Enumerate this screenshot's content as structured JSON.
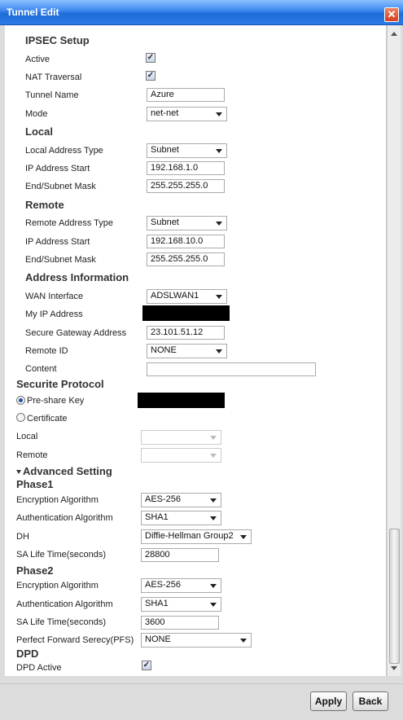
{
  "window": {
    "title": "Tunnel Edit",
    "close": "✕"
  },
  "ipsec": {
    "heading": "IPSEC Setup",
    "active_label": "Active",
    "nat_label": "NAT Traversal",
    "tunnel_name_label": "Tunnel Name",
    "tunnel_name_value": "Azure",
    "mode_label": "Mode",
    "mode_value": "net-net"
  },
  "local": {
    "heading": "Local",
    "address_type_label": "Local Address Type",
    "address_type_value": "Subnet",
    "ip_start_label": "IP Address Start",
    "ip_start_value": "192.168.1.0",
    "mask_label": "End/Subnet Mask",
    "mask_value": "255.255.255.0"
  },
  "remote": {
    "heading": "Remote",
    "address_type_label": "Remote Address Type",
    "address_type_value": "Subnet",
    "ip_start_label": "IP Address Start",
    "ip_start_value": "192.168.10.0",
    "mask_label": "End/Subnet Mask",
    "mask_value": "255.255.255.0"
  },
  "address_info": {
    "heading": "Address Information",
    "wan_label": "WAN Interface",
    "wan_value": "ADSLWAN1",
    "my_ip_label": "My IP Address",
    "gateway_label": "Secure Gateway Address",
    "gateway_value": "23.101.51.12",
    "remote_id_label": "Remote ID",
    "remote_id_value": "NONE",
    "content_label": "Content",
    "content_value": ""
  },
  "protocol": {
    "heading": "Securite Protocol",
    "preshare_label": "Pre-share Key",
    "certificate_label": "Certificate",
    "local_label": "Local",
    "remote_label": "Remote"
  },
  "advanced": {
    "heading": "Advanced Setting"
  },
  "phase1": {
    "heading": "Phase1",
    "enc_label": "Encryption Algorithm",
    "enc_value": "AES-256",
    "auth_label": "Authentication Algorithm",
    "auth_value": "SHA1",
    "dh_label": "DH",
    "dh_value": "Diffie-Hellman Group2",
    "life_label": "SA Life Time(seconds)",
    "life_value": "28800"
  },
  "phase2": {
    "heading": "Phase2",
    "enc_label": "Encryption Algorithm",
    "enc_value": "AES-256",
    "auth_label": "Authentication Algorithm",
    "auth_value": "SHA1",
    "life_label": "SA Life Time(seconds)",
    "life_value": "3600",
    "pfs_label": "Perfect Forward Serecy(PFS)",
    "pfs_value": "NONE"
  },
  "dpd": {
    "heading": "DPD",
    "active_label": "DPD Active"
  },
  "footer": {
    "apply": "Apply",
    "back": "Back"
  },
  "checks": {
    "mark": "✓"
  },
  "colors": {
    "titlebar": "#2c7ae6",
    "close": "#d4401c"
  }
}
